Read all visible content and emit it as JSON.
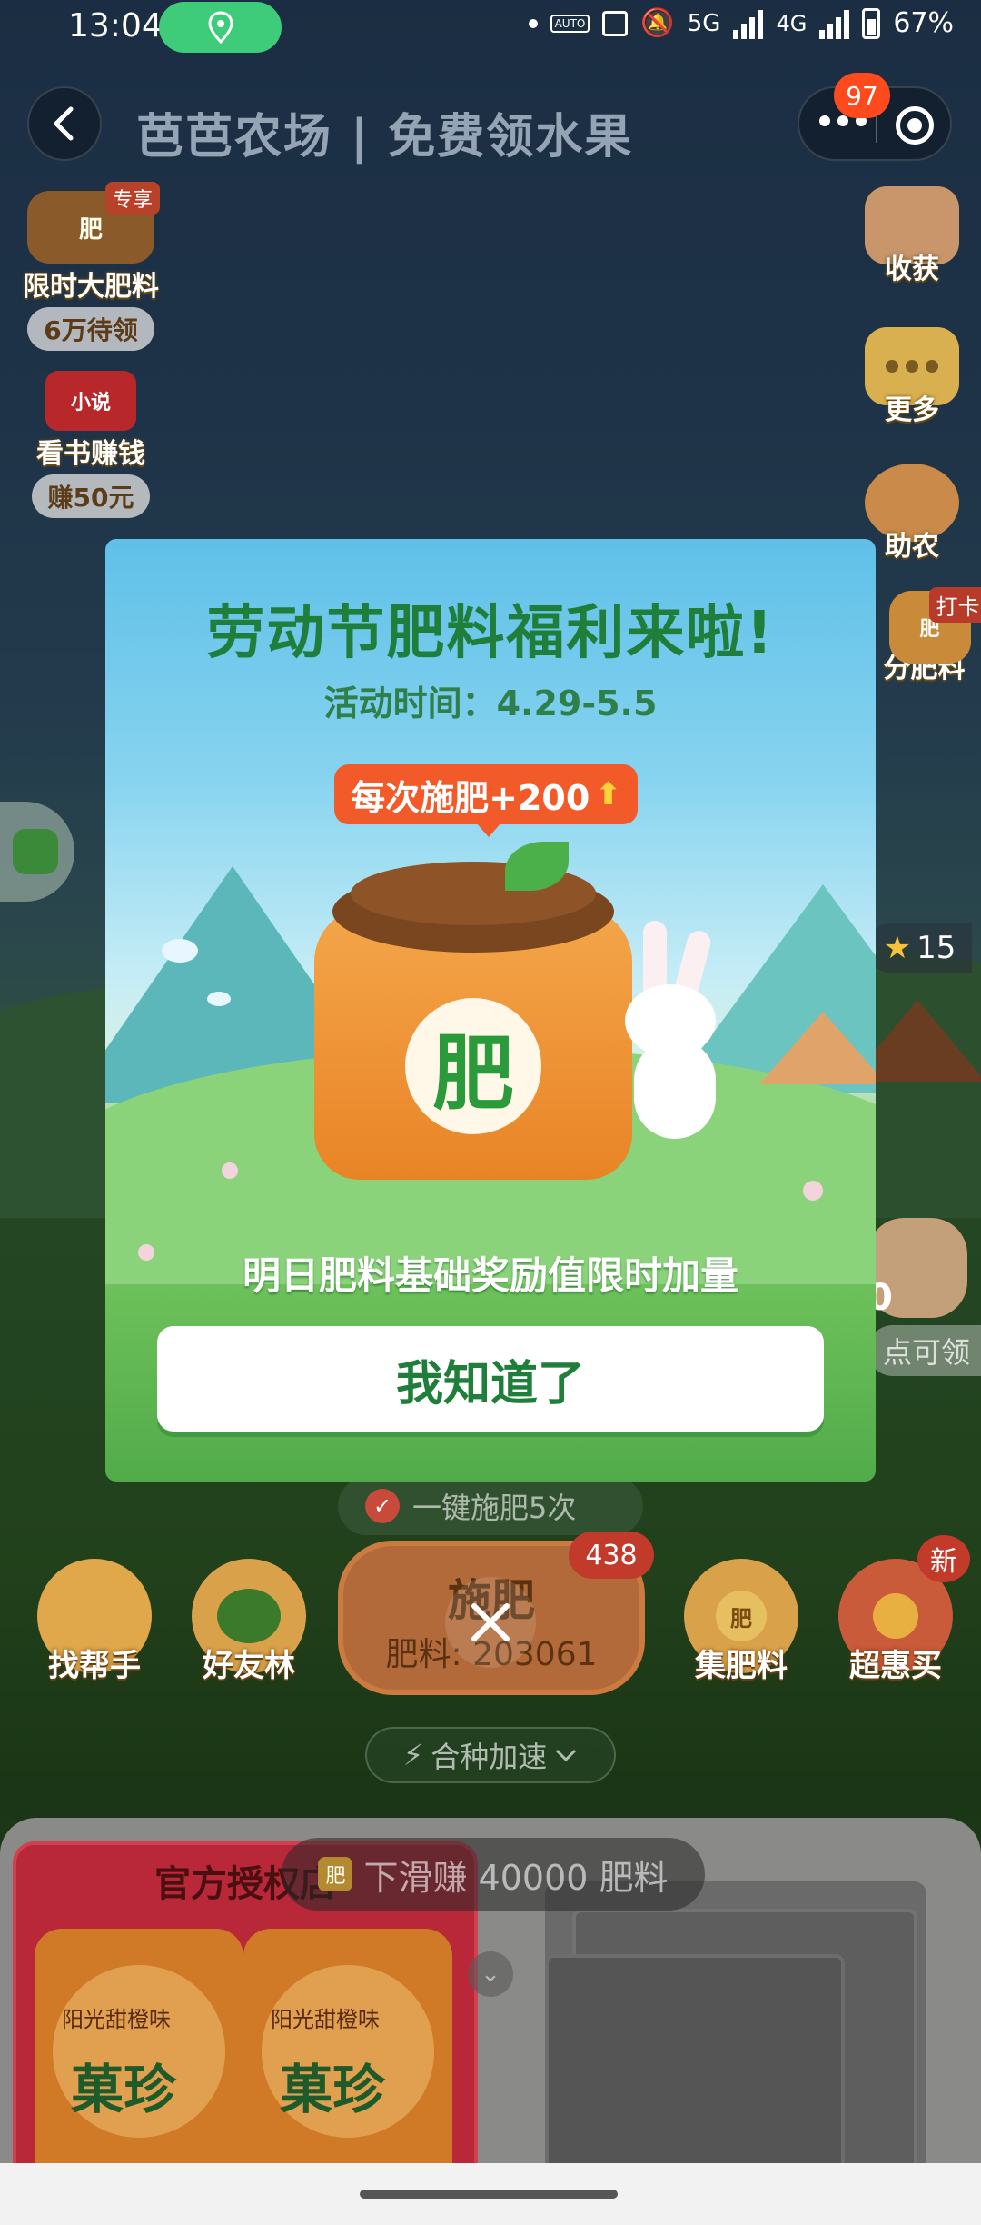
{
  "status_bar": {
    "time": "13:04",
    "network": "5G",
    "network2": "4G",
    "sim1": "1",
    "sim2": "2",
    "battery": "67%"
  },
  "header": {
    "title": "芭芭农场 | 免费领水果",
    "menu_badge": "97"
  },
  "left_widgets": {
    "limited": {
      "ribbon": "专享",
      "icon_text": "肥",
      "label": "限时大肥料",
      "pill": "6万待领"
    },
    "novel": {
      "icon_text": "小说",
      "label": "看书赚钱",
      "pill": "赚50元"
    }
  },
  "right_widgets": {
    "harvest": "收获",
    "more": "更多",
    "help": "助农",
    "fertilizer": {
      "tag": "打卡",
      "icon_text": "肥",
      "label": "分肥料"
    },
    "count": "15",
    "claim": "点可领",
    "claim_digit": "0"
  },
  "bottom_bar": {
    "one_key": "一键施肥5次",
    "fertilize": "施肥",
    "fertilizer_count": "肥料: 203061",
    "badge": "438",
    "buttons": [
      "找帮手",
      "好友林",
      "集肥料",
      "超惠买"
    ],
    "new_badge": "新",
    "ji_icon": "肥",
    "speed": "合种加速"
  },
  "feed": {
    "product_title": "官方授权店",
    "brand": "菓珍",
    "flavor": "阳光甜橙味",
    "swipe_prompt": "下滑赚 40000 肥料"
  },
  "modal": {
    "title": "劳动节肥料福利来啦!",
    "subtitle": "活动时间：4.29-5.5",
    "bonus_tag": "每次施肥+200",
    "bag_text": "肥",
    "description": "明日肥料基础奖励值限时加量",
    "ok_button": "我知道了"
  },
  "colors": {
    "accent_green": "#1f7f3a",
    "badge_orange": "#ff4a1e",
    "location_pill": "#3ecc7a"
  }
}
